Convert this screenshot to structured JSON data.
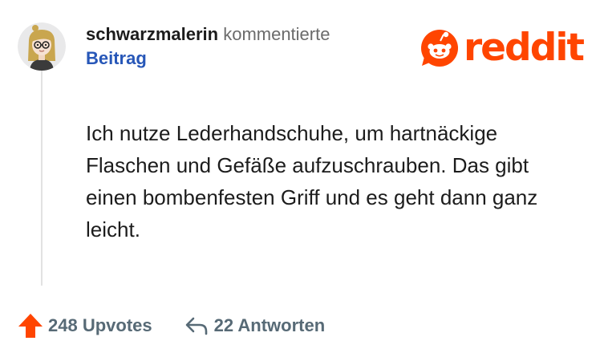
{
  "comment": {
    "username": "schwarzmalerin",
    "action": "kommentierte",
    "post_link": "Beitrag",
    "avatar_icon": "user-avatar-icon",
    "body": "Ich nutze Lederhandschuhe, um hartnäckige Flaschen und Gefäße aufzuschrauben. Das gibt einen bombenfesten Griff und es geht dann ganz leicht."
  },
  "brand": {
    "name": "reddit",
    "icon": "reddit-snoo-icon",
    "color": "#ff4500"
  },
  "footer": {
    "upvotes_label": "248 Upvotes",
    "upvote_icon": "upvote-arrow-icon",
    "upvote_color": "#ff4500",
    "replies_label": "22 Antworten",
    "reply_icon": "reply-arrow-icon"
  },
  "colors": {
    "link": "#2757b8",
    "muted": "#576a76",
    "text": "#1c1c1c"
  }
}
